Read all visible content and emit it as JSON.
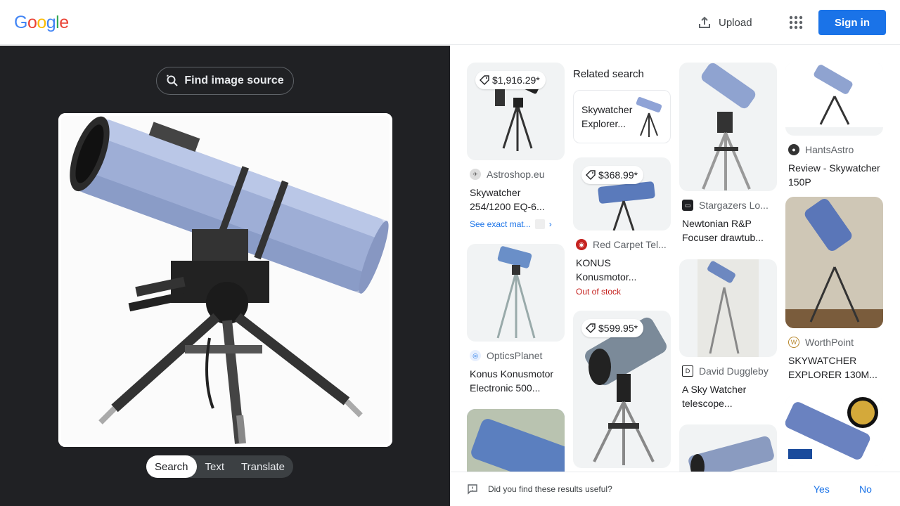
{
  "header": {
    "logo_letters": [
      {
        "ch": "G",
        "color": "#4285F4"
      },
      {
        "ch": "o",
        "color": "#EA4335"
      },
      {
        "ch": "o",
        "color": "#FBBC05"
      },
      {
        "ch": "g",
        "color": "#4285F4"
      },
      {
        "ch": "l",
        "color": "#34A853"
      },
      {
        "ch": "e",
        "color": "#EA4335"
      }
    ],
    "upload_label": "Upload",
    "signin_label": "Sign in",
    "accent": "#1a73e8"
  },
  "left": {
    "find_source_label": "Find image source",
    "modes": [
      "Search",
      "Text",
      "Translate"
    ],
    "active_mode": "Search"
  },
  "results": {
    "col1": [
      {
        "price": "$1,916.29*",
        "source": "Astroshop.eu",
        "title": "Skywatcher 254/1200 EQ-6...",
        "exact": "See exact mat..."
      },
      {
        "source": "OpticsPlanet",
        "title": "Konus Konusmotor Electronic 500..."
      }
    ],
    "col2": {
      "related_heading": "Related search",
      "related_item": "Skywatcher Explorer...",
      "items": [
        {
          "price": "$368.99*",
          "source": "Red Carpet Tel...",
          "title": "KONUS Konusmotor...",
          "status": "Out of stock"
        },
        {
          "price": "$599.95*"
        }
      ]
    },
    "col3": [
      {
        "source": "Stargazers Lo...",
        "title": "Newtonian R&P Focuser drawtub..."
      },
      {
        "source": "David Duggleby",
        "title": "A Sky Watcher telescope..."
      }
    ],
    "col4": [
      {
        "source": "HantsAstro",
        "title": "Review - Skywatcher 150P"
      },
      {
        "source": "WorthPoint",
        "title": "SKYWATCHER EXPLORER 130M..."
      }
    ]
  },
  "feedback": {
    "question": "Did you find these results useful?",
    "yes": "Yes",
    "no": "No"
  }
}
